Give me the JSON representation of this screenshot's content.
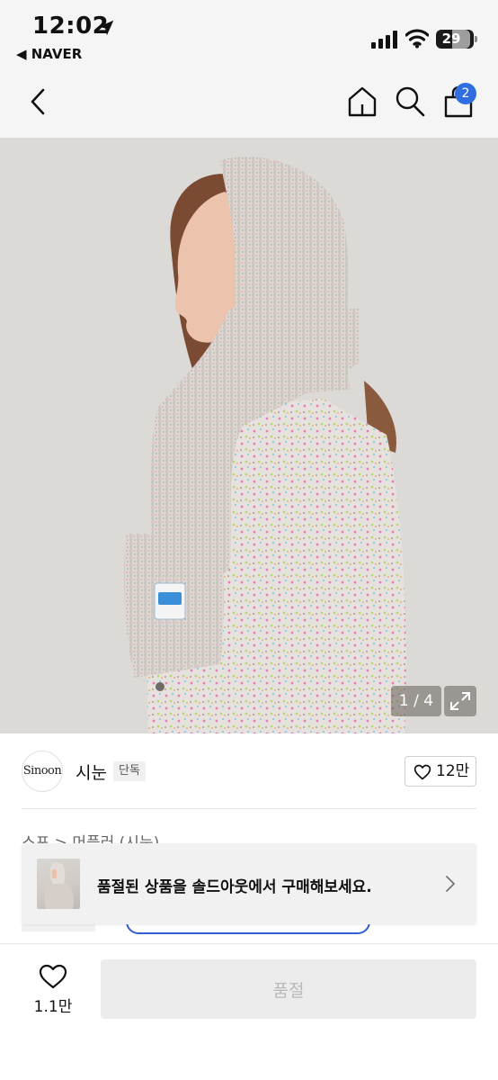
{
  "status_bar": {
    "time": "12:02",
    "back_app": "◀ NAVER",
    "battery": "29",
    "icons": [
      "location-arrow-icon",
      "signal-icon",
      "wifi-icon",
      "battery-icon"
    ]
  },
  "nav": {
    "icons": [
      "chevron-left-icon",
      "home-icon",
      "search-icon",
      "shopping-bag-icon"
    ],
    "cart_badge": "2"
  },
  "gallery": {
    "counter": "1 / 4",
    "expand_icon": "expand-icon"
  },
  "brand": {
    "logo_text": "Sinoon",
    "name": "시눈",
    "badge": "단독",
    "like_count": "12만"
  },
  "breadcrumb": "스포 > 머플러 (시눈)",
  "toast": {
    "message": "품절된 상품을 솔드아웃에서 구매해보세요.",
    "chevron_icon": "chevron-right-icon"
  },
  "bottom_bar": {
    "wish_count": "1.1만",
    "soldout_label": "품절"
  },
  "colors": {
    "accent": "#2f6de1",
    "surface": "#f5f5f5",
    "disabled_button": "#ececec",
    "disabled_text": "#b9b9b9"
  }
}
